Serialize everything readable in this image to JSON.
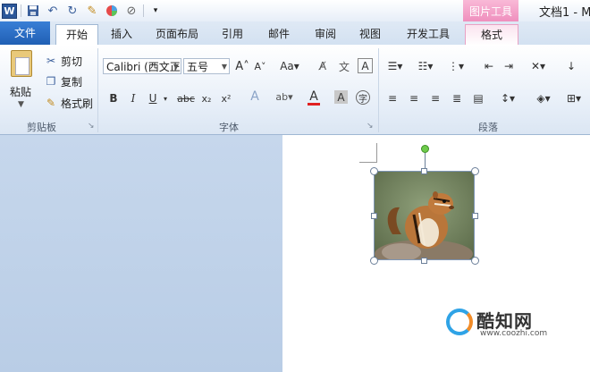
{
  "titlebar": {
    "doc_title": "文档1 - M",
    "context_header": "图片工具"
  },
  "tabs": {
    "file": "文件",
    "home": "开始",
    "insert": "插入",
    "layout": "页面布局",
    "references": "引用",
    "mailings": "邮件",
    "review": "审阅",
    "view": "视图",
    "developer": "开发工具",
    "format": "格式"
  },
  "clipboard": {
    "paste": "粘贴",
    "cut": "剪切",
    "copy": "复制",
    "format_painter": "格式刷",
    "group_label": "剪贴板"
  },
  "font": {
    "font_name": "Calibri (西文正",
    "font_size": "五号",
    "group_label": "字体"
  },
  "paragraph": {
    "group_label": "段落"
  },
  "watermark": {
    "name": "酷知网",
    "url": "www.coozhi.com"
  },
  "colors": {
    "file_tab": "#2a6ac4",
    "context_tab": "#ef8fbd",
    "font_color_bar": "#e02020"
  }
}
